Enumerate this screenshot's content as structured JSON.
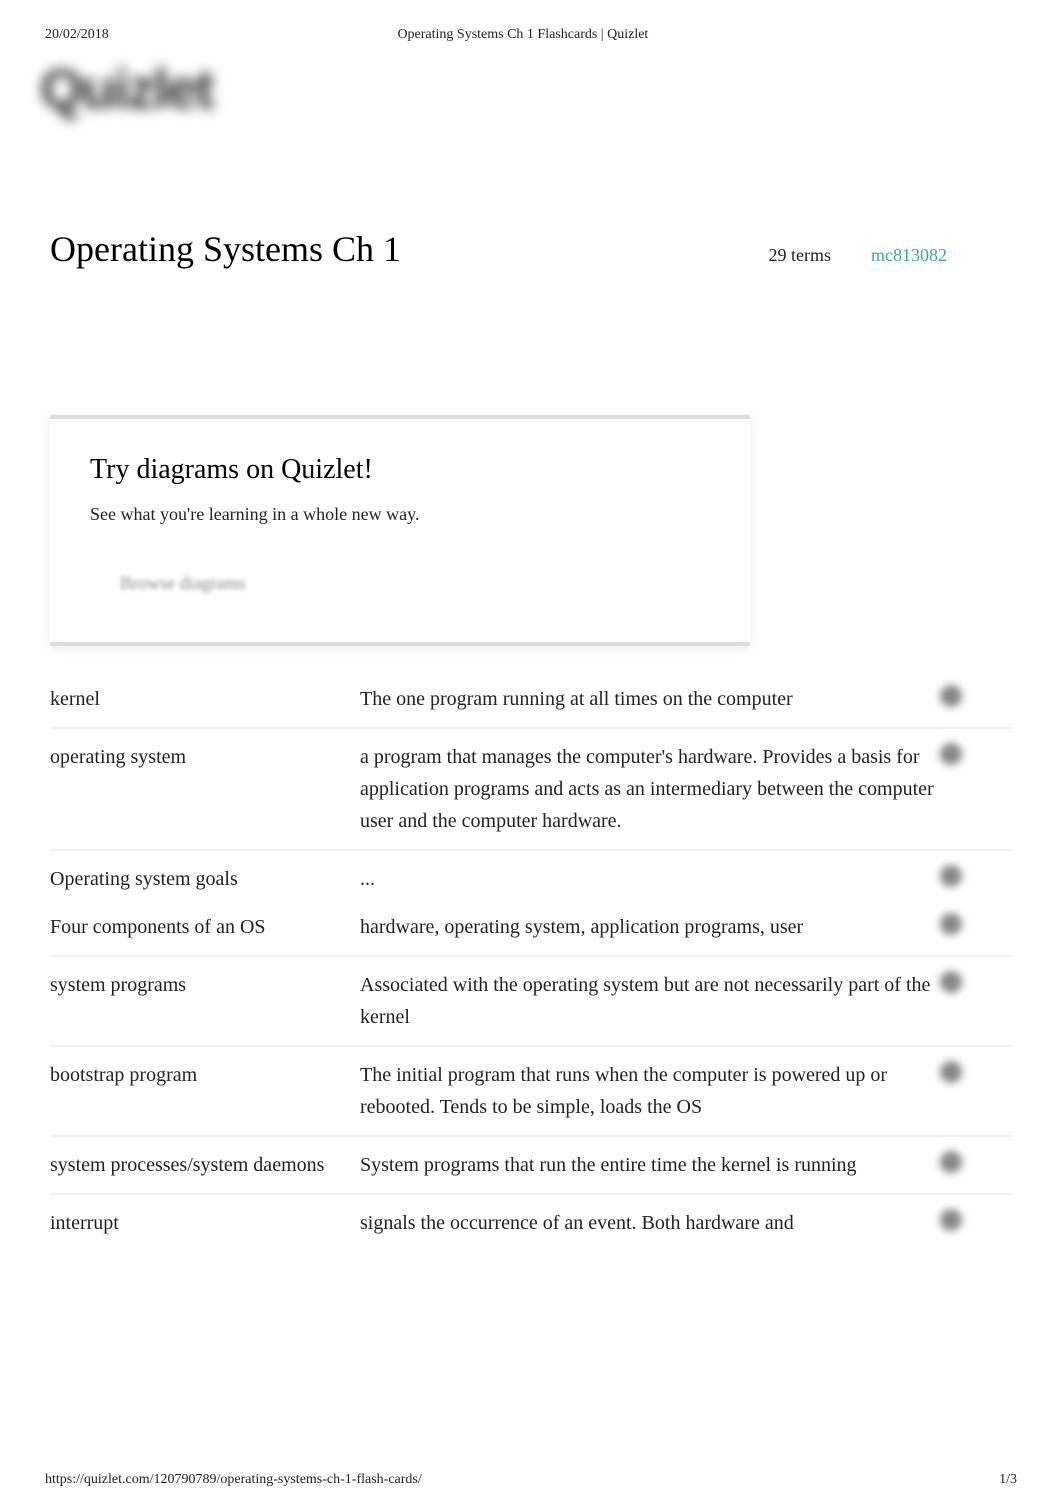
{
  "meta": {
    "date": "20/02/2018",
    "header_title": "Operating Systems Ch 1 Flashcards | Quizlet"
  },
  "logo": {
    "text": "Quizlet"
  },
  "title": {
    "heading": "Operating Systems Ch 1",
    "terms": "29 terms",
    "author": "mc813082"
  },
  "promo": {
    "title": "Try diagrams on Quizlet!",
    "subtitle": "See what you're learning in a whole new way.",
    "button": "Browse diagrams"
  },
  "cards": [
    {
      "term": "kernel",
      "definition": "The one program running at all times on the computer"
    },
    {
      "term": "operating system",
      "definition": "a program that manages the computer's hardware. Provides a basis for application programs and acts as an intermediary between the computer user and the computer hardware."
    },
    {
      "term": "Operating system goals",
      "definition": "..."
    },
    {
      "term": "Four components of an OS",
      "definition": "hardware, operating system, application programs, user"
    },
    {
      "term": "system programs",
      "definition": "Associated with the operating system but are not necessarily part of the kernel"
    },
    {
      "term": "bootstrap program",
      "definition": "The initial program that runs when the computer is powered up or rebooted. Tends to be simple, loads the OS"
    },
    {
      "term": "system processes/system daemons",
      "definition": "System programs that run the entire time the kernel is running"
    },
    {
      "term": "interrupt",
      "definition": "signals the occurrence of an event. Both hardware and"
    }
  ],
  "footer": {
    "url": "https://quizlet.com/120790789/operating-systems-ch-1-flash-cards/",
    "page": "1/3"
  }
}
